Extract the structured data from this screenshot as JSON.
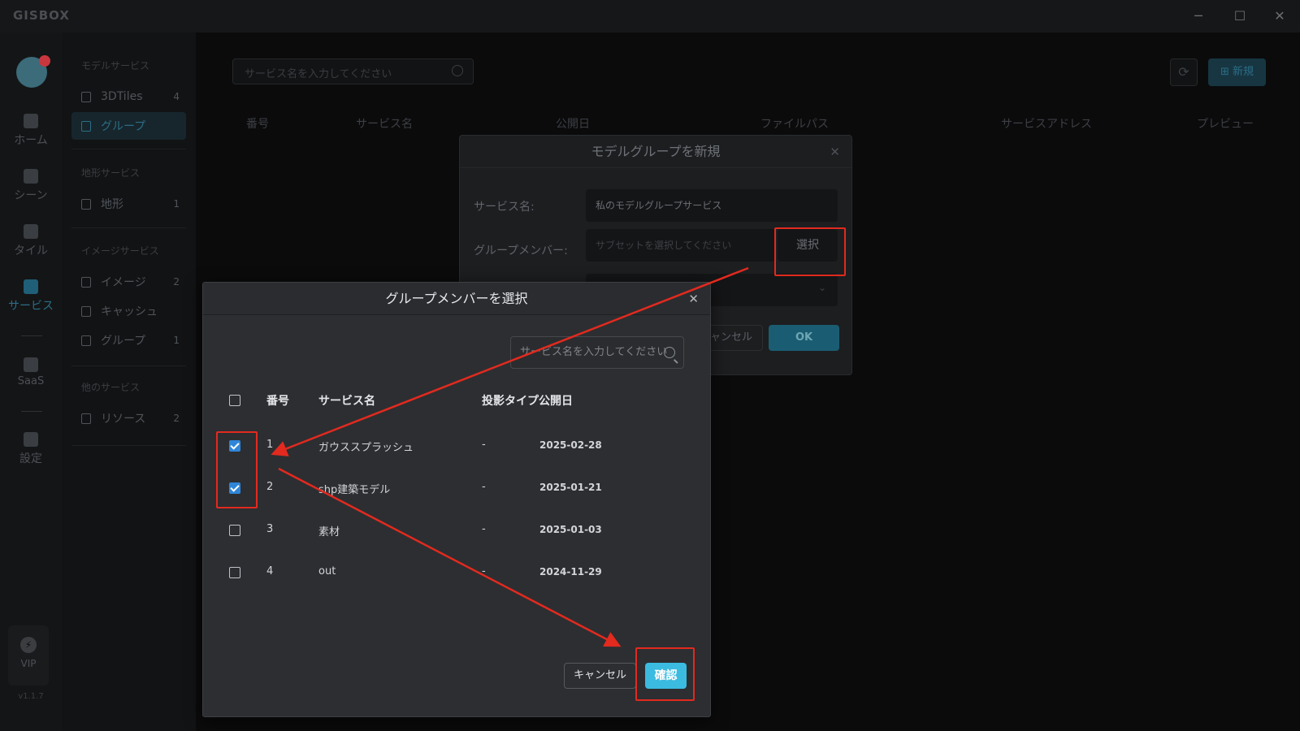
{
  "app": {
    "logo": "GISBOX",
    "version": "v1.1.7"
  },
  "window_controls": {
    "minimize": "─",
    "maximize": "☐",
    "close": "✕"
  },
  "rail": {
    "items": [
      {
        "label": "ホーム",
        "icon": "home-icon"
      },
      {
        "label": "シーン",
        "icon": "scene-icon"
      },
      {
        "label": "タイル",
        "icon": "tile-icon"
      },
      {
        "label": "サービス",
        "icon": "service-icon"
      },
      {
        "label": "SaaS",
        "icon": "saas-icon"
      },
      {
        "label": "設定",
        "icon": "settings-icon"
      }
    ],
    "vip": "VIP"
  },
  "sidebar": {
    "sections": [
      {
        "title": "モデルサービス",
        "items": [
          {
            "label": "3DTiles",
            "count": "4"
          },
          {
            "label": "グループ",
            "count": ""
          }
        ]
      },
      {
        "title": "地形サービス",
        "items": [
          {
            "label": "地形",
            "count": "1"
          }
        ]
      },
      {
        "title": "イメージサービス",
        "items": [
          {
            "label": "イメージ",
            "count": "2"
          },
          {
            "label": "キャッシュ",
            "count": ""
          },
          {
            "label": "グループ",
            "count": "1"
          }
        ]
      },
      {
        "title": "他のサービス",
        "items": [
          {
            "label": "リソース",
            "count": "2"
          }
        ]
      }
    ]
  },
  "main": {
    "search_placeholder": "サービス名を入力してください",
    "new_button": "新規",
    "columns": [
      "番号",
      "サービス名",
      "公開日",
      "ファイルパス",
      "サービスアドレス",
      "プレビュー"
    ]
  },
  "group_dialog": {
    "title": "モデルグループを新規",
    "service_name_label": "サービス名:",
    "service_name_value": "私のモデルグループサービス",
    "members_label": "グループメンバー:",
    "members_placeholder": "サブセットを選択してください",
    "select_button": "選択",
    "cancel_button": "キャンセル",
    "ok_button": "OK"
  },
  "member_dialog": {
    "title": "グループメンバーを選択",
    "search_placeholder": "サービス名を入力してください",
    "headers": {
      "number": "番号",
      "name": "サービス名",
      "projection": "投影タイプ",
      "date": "公開日"
    },
    "rows": [
      {
        "number": "1",
        "name": "ガウススプラッシュ",
        "projection": "-",
        "date": "2025-02-28",
        "checked": true
      },
      {
        "number": "2",
        "name": "shp建築モデル",
        "projection": "-",
        "date": "2025-01-21",
        "checked": true
      },
      {
        "number": "3",
        "name": "素材",
        "projection": "-",
        "date": "2025-01-03",
        "checked": false
      },
      {
        "number": "4",
        "name": "out",
        "projection": "-",
        "date": "2024-11-29",
        "checked": false
      }
    ],
    "cancel_button": "キャンセル",
    "confirm_button": "確認"
  },
  "colors": {
    "annotation_red": "#e22a1f",
    "accent": "#3bbbe0",
    "checkbox": "#2f86d8"
  }
}
